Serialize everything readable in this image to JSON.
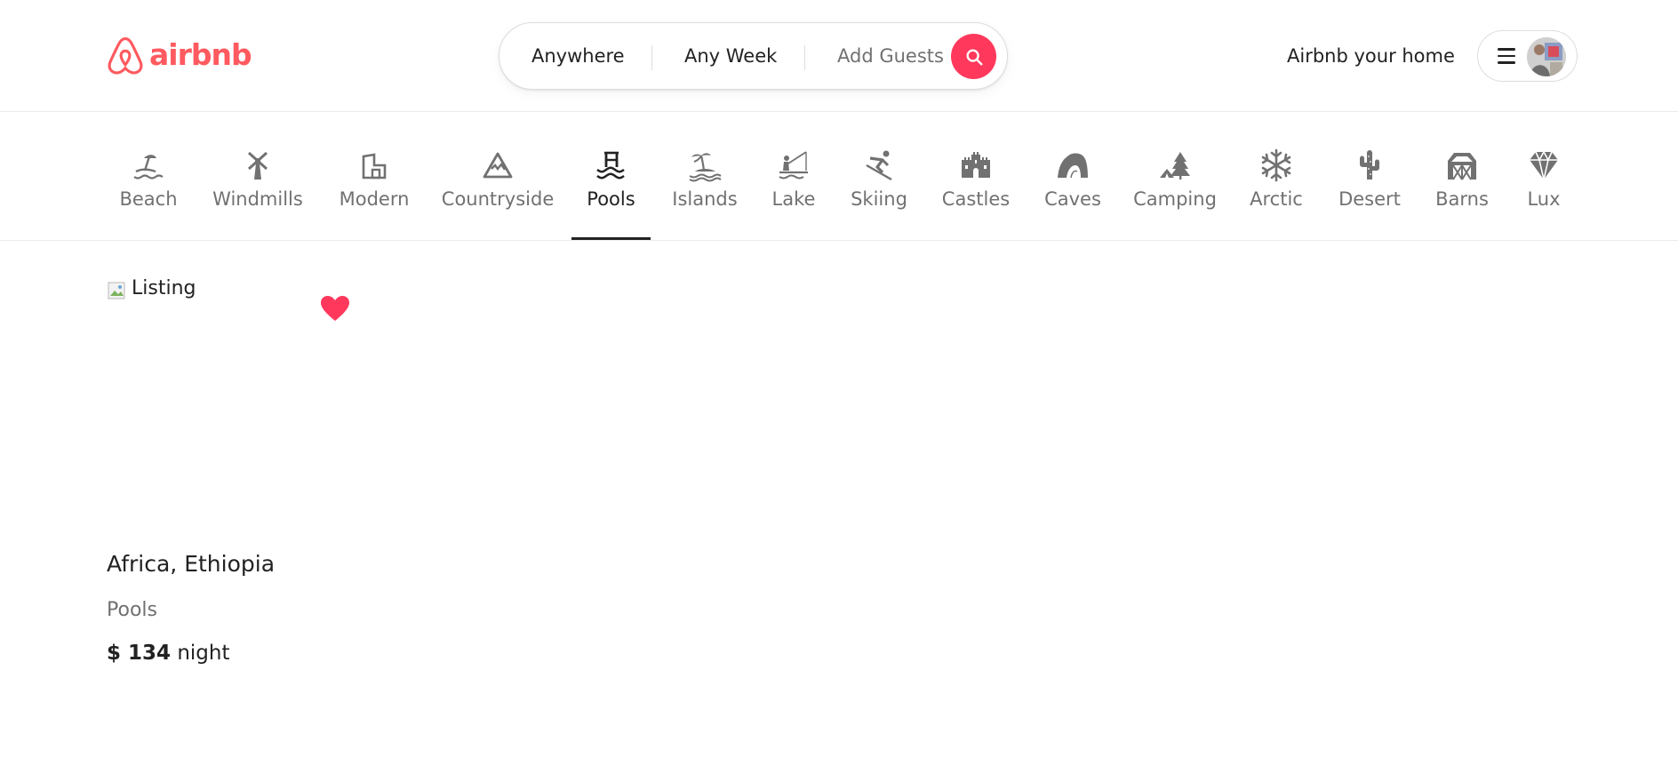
{
  "header": {
    "logo_text": "airbnb",
    "search": {
      "anywhere": "Anywhere",
      "week": "Any Week",
      "guests": "Add Guests",
      "search_icon": "search-icon"
    },
    "host_link": "Airbnb your home",
    "menu_icon": "hamburger-menu-icon"
  },
  "categories": [
    {
      "label": "Beach",
      "icon": "beach-umbrella-icon",
      "active": false
    },
    {
      "label": "Windmills",
      "icon": "windmill-icon",
      "active": false
    },
    {
      "label": "Modern",
      "icon": "modern-house-icon",
      "active": false
    },
    {
      "label": "Countryside",
      "icon": "mountain-icon",
      "active": false
    },
    {
      "label": "Pools",
      "icon": "pool-ladder-icon",
      "active": true
    },
    {
      "label": "Islands",
      "icon": "island-palm-icon",
      "active": false
    },
    {
      "label": "Lake",
      "icon": "lake-fishing-icon",
      "active": false
    },
    {
      "label": "Skiing",
      "icon": "skier-icon",
      "active": false
    },
    {
      "label": "Castles",
      "icon": "castle-icon",
      "active": false
    },
    {
      "label": "Caves",
      "icon": "cave-icon",
      "active": false
    },
    {
      "label": "Camping",
      "icon": "tent-tree-icon",
      "active": false
    },
    {
      "label": "Arctic",
      "icon": "snowflake-icon",
      "active": false
    },
    {
      "label": "Desert",
      "icon": "cactus-icon",
      "active": false
    },
    {
      "label": "Barns",
      "icon": "barn-icon",
      "active": false
    },
    {
      "label": "Lux",
      "icon": "diamond-icon",
      "active": false
    }
  ],
  "listing": {
    "image_alt": "Listing",
    "favorite_icon": "heart-icon",
    "location": "Africa, Ethiopia",
    "category": "Pools",
    "price_amount": "$ 134",
    "price_unit": "night"
  },
  "colors": {
    "brand": "#ff5a5f",
    "search_button": "#ff385c",
    "heart": "#ff385c",
    "muted_text": "#717171",
    "icon_gray": "#717171"
  }
}
